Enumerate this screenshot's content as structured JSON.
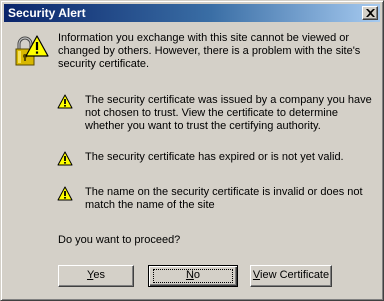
{
  "window": {
    "title": "Security Alert",
    "close_symbol": "×"
  },
  "intro_text": "Information you exchange with this site cannot be viewed or changed by others. However, there is a problem with the site's security certificate.",
  "warnings": [
    {
      "icon": "warning-icon",
      "text": "The security certificate was issued by a company you have not chosen to trust. View the certificate to determine whether you want to trust the certifying authority."
    },
    {
      "icon": "warning-icon",
      "text": "The security certificate has expired or is not yet valid."
    },
    {
      "icon": "warning-icon",
      "text": "The name on the security certificate is invalid or does not match the name of the site"
    }
  ],
  "question": "Do you want to proceed?",
  "buttons": {
    "yes": {
      "mnemonic": "Y",
      "rest": "es"
    },
    "no": {
      "mnemonic": "N",
      "rest": "o"
    },
    "view_certificate": {
      "mnemonic": "V",
      "rest": "iew Certificate"
    }
  },
  "colors": {
    "face": "#d4d0c8",
    "title_gradient_start": "#0a246a",
    "title_gradient_end": "#a6caf0",
    "warning_fill": "#ffff00",
    "lock_gold": "#d8b800"
  },
  "icons": {
    "header": "padlock-warning-icon"
  }
}
